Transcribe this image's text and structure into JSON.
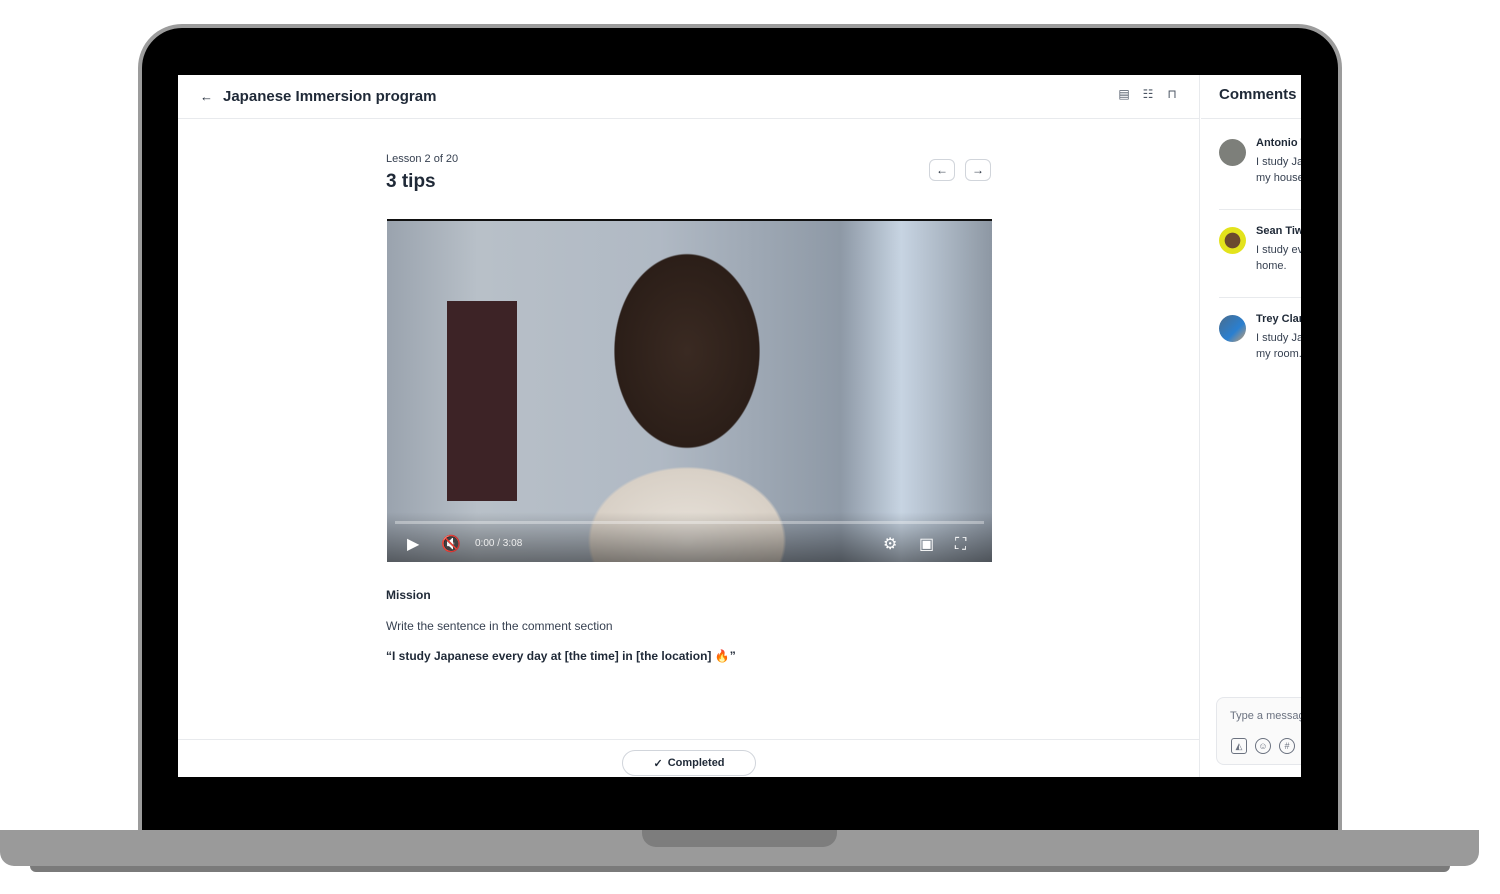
{
  "header": {
    "back_icon": "arrow-left",
    "title": "Japanese Immersion program"
  },
  "lesson": {
    "counter": "Lesson 2 of 20",
    "title": "3 tips"
  },
  "video": {
    "time": "0:00 / 3:08",
    "progress": 0
  },
  "mission": {
    "heading": "Mission",
    "instruction": "Write the sentence in the comment section",
    "quote": "“I study Japanese every day at [the time] in [the location] 🔥”"
  },
  "footer": {
    "completed_label": "Completed"
  },
  "comments": {
    "title": "Comments",
    "items": [
      {
        "name": "Antonio T",
        "line1": "I study Ja",
        "line2": "my house"
      },
      {
        "name": "Sean Tiw",
        "line1": "I study ev",
        "line2": "home."
      },
      {
        "name": "Trey Clar",
        "line1": "I study Ja",
        "line2": "my room."
      }
    ],
    "placeholder": "Type a message"
  }
}
